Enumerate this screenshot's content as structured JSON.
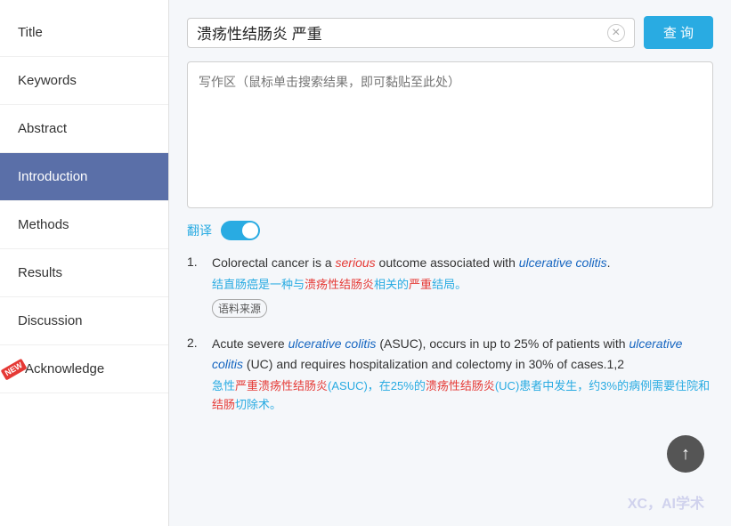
{
  "sidebar": {
    "items": [
      {
        "id": "title",
        "label": "Title",
        "active": false,
        "new": false
      },
      {
        "id": "keywords",
        "label": "Keywords",
        "active": false,
        "new": false
      },
      {
        "id": "abstract",
        "label": "Abstract",
        "active": false,
        "new": false
      },
      {
        "id": "introduction",
        "label": "Introduction",
        "active": true,
        "new": false
      },
      {
        "id": "methods",
        "label": "Methods",
        "active": false,
        "new": false
      },
      {
        "id": "results",
        "label": "Results",
        "active": false,
        "new": false
      },
      {
        "id": "discussion",
        "label": "Discussion",
        "active": false,
        "new": false
      },
      {
        "id": "acknowledge",
        "label": "Acknowledge",
        "active": false,
        "new": true
      }
    ]
  },
  "search": {
    "query": "溃疡性结肠炎 严重",
    "placeholder": "写作区（鼠标单击搜索结果，即可黏贴至此处）",
    "clear_label": "×",
    "search_label": "查 询"
  },
  "translate": {
    "label": "翻译"
  },
  "results": [
    {
      "num": "1.",
      "en_parts": [
        {
          "text": "Colorectal cancer is a ",
          "style": "normal"
        },
        {
          "text": "serious",
          "style": "red"
        },
        {
          "text": " outcome associated with ",
          "style": "normal"
        },
        {
          "text": "ulcerative colitis",
          "style": "blue"
        },
        {
          "text": ".",
          "style": "normal"
        }
      ],
      "zh": "结直肠癌是一种与溃疡性结肠炎相关的严重结局。",
      "zh_highlights": [
        "溃疡性结肠炎",
        "严重"
      ],
      "source": "语料来源"
    },
    {
      "num": "2.",
      "en_parts": [
        {
          "text": "Acute severe ",
          "style": "normal"
        },
        {
          "text": "ulcerative colitis",
          "style": "blue"
        },
        {
          "text": " (ASUC), occurs in up to 25% of patients with ",
          "style": "normal"
        },
        {
          "text": "ulcerative colitis",
          "style": "blue"
        },
        {
          "text": " (UC) and requires hospitalization and colectomy in 30% of cases.1,2",
          "style": "normal"
        }
      ],
      "zh": "急性严重溃疡性结肠炎(ASUC)，在25%的溃疡性结肠炎(UC)患者中发生，约3%的病例需要住院和结肠切除术。",
      "zh_highlights": [
        "严重溃疡性结肠炎",
        "溃疡性结肠炎",
        "结肠"
      ],
      "source": null
    }
  ],
  "watermark": "XC，AI学术",
  "scroll_up": "↑"
}
